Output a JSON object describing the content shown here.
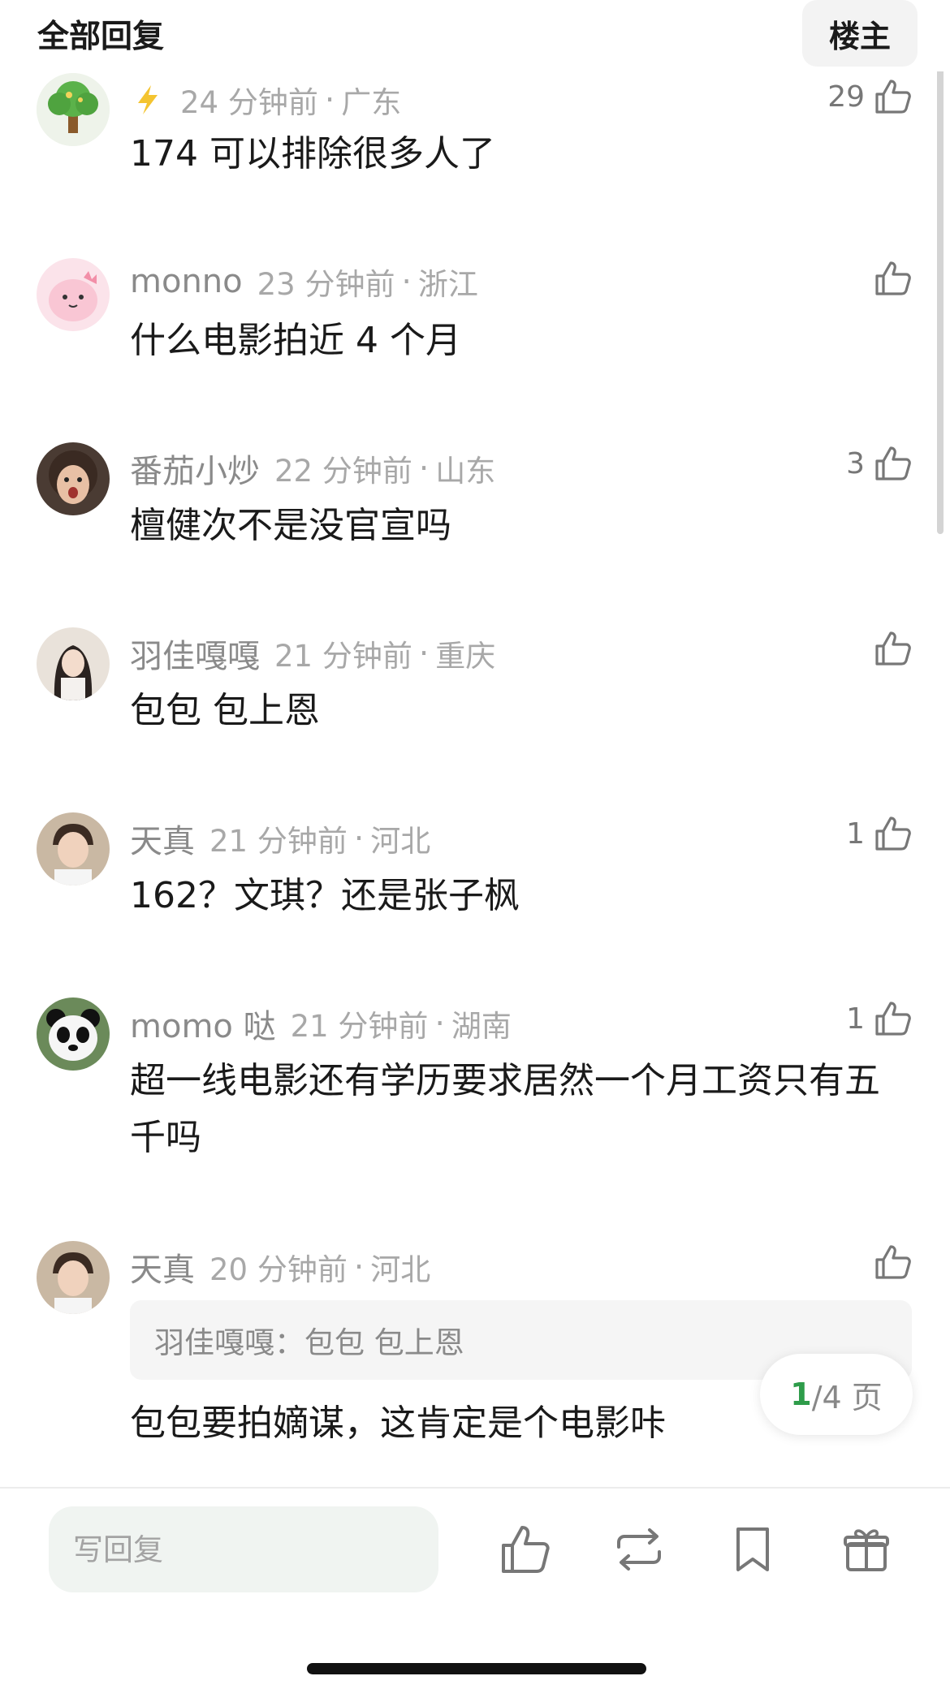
{
  "header": {
    "title": "全部回复",
    "op_button": "楼主"
  },
  "comments": [
    {
      "username": "",
      "time": "24 分钟前",
      "location": "广东",
      "likes": "29",
      "text": "174 可以排除很多人了"
    },
    {
      "username": "monno",
      "time": "23 分钟前",
      "location": "浙江",
      "likes": "",
      "text": "什么电影拍近 4 个月"
    },
    {
      "username": "番茄小炒",
      "time": "22 分钟前",
      "location": "山东",
      "likes": "3",
      "text": "檀健次不是没官宣吗"
    },
    {
      "username": "羽佳嘎嘎",
      "time": "21 分钟前",
      "location": "重庆",
      "likes": "",
      "text": "包包 包上恩"
    },
    {
      "username": "天真",
      "time": "21 分钟前",
      "location": "河北",
      "likes": "1",
      "text": "162？文琪？还是张子枫"
    },
    {
      "username": "momo 哒",
      "time": "21 分钟前",
      "location": "湖南",
      "likes": "1",
      "text": "超一线电影还有学历要求居然一个月工资只有五千吗"
    },
    {
      "username": "天真",
      "time": "20 分钟前",
      "location": "河北",
      "likes": "",
      "quote": "羽佳嘎嘎：包包 包上恩",
      "text": "包包要拍嫡谋，这肯定是个电影咔"
    }
  ],
  "meta_separator": "·",
  "pager": {
    "current": "1",
    "total_suffix": "/4 页"
  },
  "bottom_bar": {
    "reply_placeholder": "写回复"
  },
  "colors": {
    "accent_green": "#2e9c4a",
    "meta_gray": "#a8a8a8",
    "input_bg": "#f0f4f1"
  },
  "icons": [
    "tree-avatar-icon",
    "thumbs-up-icon",
    "repost-icon",
    "bookmark-icon",
    "gift-icon",
    "lightning-badge-icon"
  ]
}
